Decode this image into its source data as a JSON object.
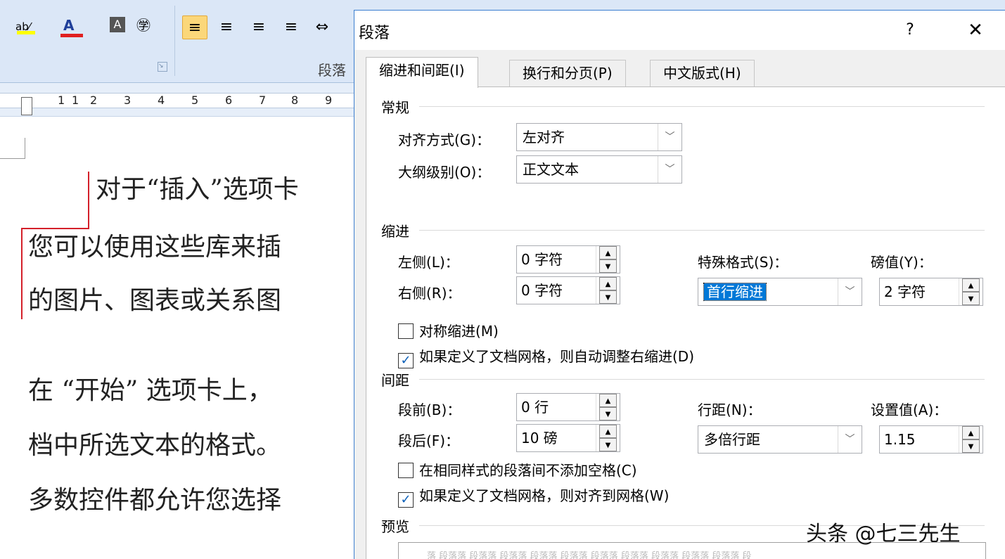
{
  "ribbon": {
    "paragraph_group_label": "段落",
    "launcher_glyph": "↘",
    "font_buttons": [
      "ab⁄",
      "A",
      "A",
      "㊫"
    ],
    "align_buttons": [
      "≡",
      "≡",
      "≡",
      "≡",
      "⇔"
    ]
  },
  "ruler": {
    "ticks": [
      "1",
      "1",
      "2",
      "3",
      "4",
      "5",
      "6",
      "7",
      "8",
      "9"
    ]
  },
  "document": {
    "lines": [
      "对于“插入”选项卡",
      "您可以使用这些库来插",
      "的图片、图表或关系图",
      "在 “开始” 选项卡上，",
      "档中所选文本的格式。",
      "多数控件都允许您选择"
    ]
  },
  "dialog": {
    "title": "段落",
    "help": "?",
    "close": "✕",
    "tabs": [
      {
        "label": "缩进和间距(I)",
        "active": true
      },
      {
        "label": "换行和分页(P)",
        "active": false
      },
      {
        "label": "中文版式(H)",
        "active": false
      }
    ],
    "general": {
      "heading": "常规",
      "alignment_label": "对齐方式(G)：",
      "alignment_value": "左对齐",
      "outline_label": "大纲级别(O)：",
      "outline_value": "正文文本"
    },
    "indent": {
      "heading": "缩进",
      "left_label": "左侧(L)：",
      "left_value": "0 字符",
      "right_label": "右侧(R)：",
      "right_value": "0 字符",
      "special_label": "特殊格式(S)：",
      "special_value": "首行缩进",
      "by_label": "磅值(Y)：",
      "by_value": "2 字符",
      "mirror_label": "对称缩进(M)",
      "mirror_checked": false,
      "auto_adjust_label": "如果定义了文档网格，则自动调整右缩进(D)",
      "auto_adjust_checked": true
    },
    "spacing": {
      "heading": "间距",
      "before_label": "段前(B)：",
      "before_value": "0 行",
      "after_label": "段后(F)：",
      "after_value": "10 磅",
      "line_label": "行距(N)：",
      "line_value": "多倍行距",
      "at_label": "设置值(A)：",
      "at_value": "1.15",
      "no_space_label": "在相同样式的段落间不添加空格(C)",
      "no_space_checked": false,
      "snap_grid_label": "如果定义了文档网格，则对齐到网格(W)",
      "snap_grid_checked": true
    },
    "preview": {
      "heading": "预览",
      "sample": "落 段落落 段落落 段落落 段落落 段落落 段落落 段落落 段落落 段落落 段落落 段"
    }
  },
  "watermark": "头条 @七三先生",
  "glyphs": {
    "check": "✓",
    "dropdown": "﹀",
    "spin_up": "▲",
    "spin_down": "▼"
  },
  "colors": {
    "selection": "#0078d7",
    "ribbon": "#dbe7f7",
    "revision_bar": "#d4202a"
  }
}
